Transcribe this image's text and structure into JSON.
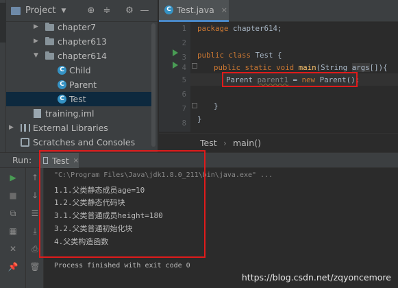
{
  "project": {
    "title": "Project",
    "items": [
      {
        "label": "chapter7",
        "kind": "folder",
        "state": "collapsed"
      },
      {
        "label": "chapter613",
        "kind": "folder",
        "state": "collapsed"
      },
      {
        "label": "chapter614",
        "kind": "folder",
        "state": "expanded"
      },
      {
        "label": "Child",
        "kind": "class"
      },
      {
        "label": "Parent",
        "kind": "class"
      },
      {
        "label": "Test",
        "kind": "class",
        "selected": true
      },
      {
        "label": "training.iml",
        "kind": "file"
      },
      {
        "label": "External Libraries",
        "kind": "libraries"
      },
      {
        "label": "Scratches and Consoles",
        "kind": "scratch"
      }
    ]
  },
  "editor": {
    "tab": {
      "label": "Test.java",
      "close": "×"
    },
    "line_numbers": [
      "1",
      "2",
      "3",
      "4",
      "5",
      "6",
      "7",
      "8"
    ],
    "code": {
      "l1_kw": "package",
      "l1_rest": " chapter614;",
      "l3_kw1": "public",
      "l3_kw2": "class",
      "l3_rest": " Test {",
      "l4_kw1": "public",
      "l4_kw2": "static",
      "l4_kw3": "void",
      "l4_fn": "main",
      "l4_open": "(String ",
      "l4_param": "args",
      "l4_close": "[]){",
      "l5_type": "Parent ",
      "l5_var": "parent1",
      "l5_eq": " = ",
      "l5_kw": "new",
      "l5_rest": " Parent();",
      "l7": "}",
      "l8": "}"
    },
    "breadcrumb": [
      "Test",
      "main()"
    ],
    "breadcrumb_sep": "›"
  },
  "run": {
    "label": "Run:",
    "tab": {
      "label": "Test",
      "close": "×"
    },
    "console": [
      "\"C:\\Program Files\\Java\\jdk1.8.0_211\\bin\\java.exe\" ...",
      "1.1.父类静态成员age=10",
      "1.2.父类静态代码块",
      "3.1.父类普通成员height=180",
      "3.2.父类普通初始化块",
      "4.父类构造函数",
      "",
      "Process finished with exit code 0"
    ]
  },
  "watermark": "https://blog.csdn.net/zqyoncemore",
  "colors": {
    "highlight_box": "#e01b1b",
    "selection": "#0d293e",
    "keyword": "#cc7832"
  }
}
